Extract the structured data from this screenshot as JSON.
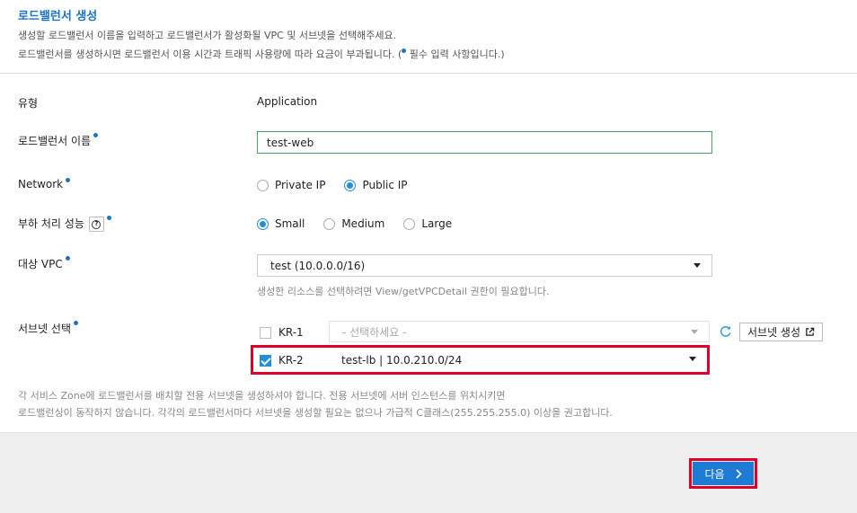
{
  "header": {
    "title": "로드밸런서 생성",
    "desc1": "생성할 로드밸런서 이름을 입력하고 로드밸런서가 활성화될 VPC 및 서브넷을 선택해주세요.",
    "desc2_pre": "로드밸런서를 생성하시면 로드밸런서 이용 시간과 트래픽 사용량에 따라 요금이 부과됩니다. (",
    "desc2_post": " 필수 입력 사항입니다.)"
  },
  "form": {
    "type_label": "유형",
    "type_value": "Application",
    "name_label": "로드밸런서 이름",
    "name_value": "test-web",
    "network_label": "Network",
    "network_options": [
      "Private IP",
      "Public IP"
    ],
    "network_selected": "Public IP",
    "load_label": "부하 처리 성능",
    "load_options": [
      "Small",
      "Medium",
      "Large"
    ],
    "load_selected": "Small",
    "vpc_label": "대상 VPC",
    "vpc_value": "test (10.0.0.0/16)",
    "vpc_hint": "생성한 리소스를 선택하려면 View/getVPCDetail 권한이 필요합니다.",
    "subnet_label": "서브넷 선택",
    "zones": [
      {
        "name": "KR-1",
        "checked": false,
        "subnet": "- 선택하세요 -"
      },
      {
        "name": "KR-2",
        "checked": true,
        "subnet": "test-lb | 10.0.210.0/24"
      }
    ],
    "create_subnet_label": "서브넷 생성",
    "note1": "각 서비스 Zone에 로드밸런서를 배치할 전용 서브넷을 생성하셔야 합니다. 전용 서브넷에 서버 인스턴스를 위치시키면",
    "note2": "로드밸런싱이 동작하지 않습니다. 각각의 로드밸런서마다 서브넷을 생성할 필요는 없으나 가급적 C클래스(255.255.255.0) 이상을 권고합니다."
  },
  "footer": {
    "next_label": "다음"
  },
  "colors": {
    "accent": "#1e90d8",
    "title": "#1a73c9",
    "highlight": "#e0002a",
    "input_border": "#3daa5c"
  }
}
